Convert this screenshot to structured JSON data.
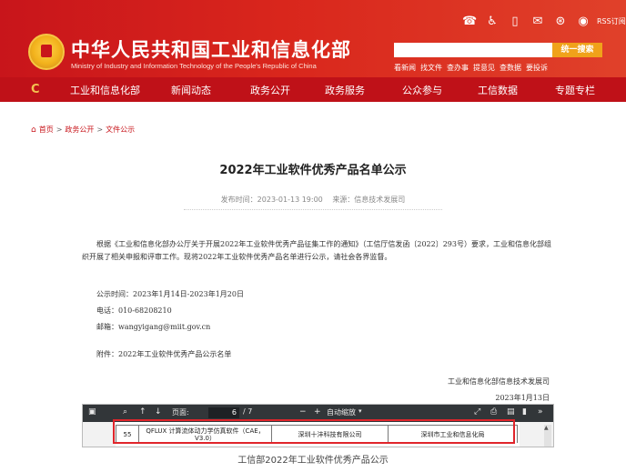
{
  "header": {
    "title": "中华人民共和国工业和信息化部",
    "subtitle": "Ministry of Industry and Information Technology of the People's Republic of China",
    "util_icons": [
      "wechat-icon",
      "accessibility-icon",
      "mobile-icon",
      "mail-icon",
      "weibo-icon",
      "sina-icon"
    ],
    "rss_label": "RSS订阅",
    "search": {
      "placeholder": "",
      "button": "统一搜索"
    },
    "quick_links": [
      "看新闻",
      "找文件",
      "查办事",
      "提意见",
      "查数据",
      "要投诉"
    ]
  },
  "nav": {
    "items": [
      "工业和信息化部",
      "新闻动态",
      "政务公开",
      "政务服务",
      "公众参与",
      "工信数据",
      "专题专栏"
    ]
  },
  "breadcrumb": [
    "首页",
    "政务公开",
    "文件公示"
  ],
  "article": {
    "title": "2022年工业软件优秀产品名单公示",
    "published_label": "发布时间：2023-01-13 19:00",
    "source_label": "来源：信息技术发展司",
    "paragraph1": "根据《工业和信息化部办公厅关于开展2022年工业软件优秀产品征集工作的通知》（工信厅信发函〔2022〕293号）要求，工业和信息化部组织开展了相关申报和评审工作。现将2022年工业软件优秀产品名单进行公示，请社会各界监督。",
    "period": "公示时间：2023年1月14日-2023年1月20日",
    "phone": "电话：010-68208210",
    "email": "邮箱：wangyigang@miit.gov.cn",
    "attachment": "附件：2022年工业软件优秀产品公示名单",
    "signature_org": "工业和信息化部信息技术发展司",
    "signature_date": "2023年1月13日"
  },
  "pdf_viewer": {
    "page_label": "页面:",
    "current_page": "6",
    "total_pages": "/ 7",
    "zoom_label": "自动缩放",
    "row": {
      "index": "55",
      "product": "QFLUX 计算流体动力学仿真软件（CAE，V3.0）",
      "company": "深圳十沣科技有限公司",
      "region": "深圳市工业和信息化局"
    }
  },
  "caption": "工信部2022年工业软件优秀产品公示"
}
